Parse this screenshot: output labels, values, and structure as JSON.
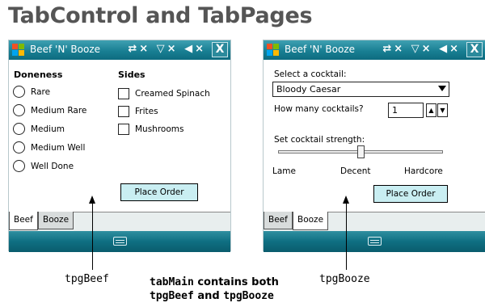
{
  "slide": {
    "title": "TabControl and TabPages"
  },
  "app": {
    "title": "Beef 'N' Booze",
    "status_icons": "⇄× ▽× ◀×",
    "close_label": "X"
  },
  "beef": {
    "doneness_heading": "Doneness",
    "doneness_options": [
      "Rare",
      "Medium Rare",
      "Medium",
      "Medium Well",
      "Well Done"
    ],
    "sides_heading": "Sides",
    "sides_options": [
      "Creamed Spinach",
      "Frites",
      "Mushrooms"
    ],
    "order_button": "Place Order"
  },
  "booze": {
    "select_label": "Select a cocktail:",
    "selected_cocktail": "Bloody Caesar",
    "quantity_label": "How many cocktails?",
    "quantity_value": "1",
    "strength_label": "Set cocktail strength:",
    "strength_level": 0.5,
    "strength_ticks": [
      "Lame",
      "Decent",
      "Hardcore"
    ],
    "order_button": "Place Order"
  },
  "tabs": [
    "Beef",
    "Booze"
  ],
  "callouts": {
    "left": "tpgBeef",
    "right": "tpgBooze",
    "note_code1": "tabMain",
    "note_text1": " contains both",
    "note_code2": "tpgBeef",
    "note_text2": " and ",
    "note_code3": "tpgBooze"
  },
  "colors": {
    "titlebar": "#197f93",
    "button_fill": "#c9eef2",
    "title_text": "#555555"
  }
}
